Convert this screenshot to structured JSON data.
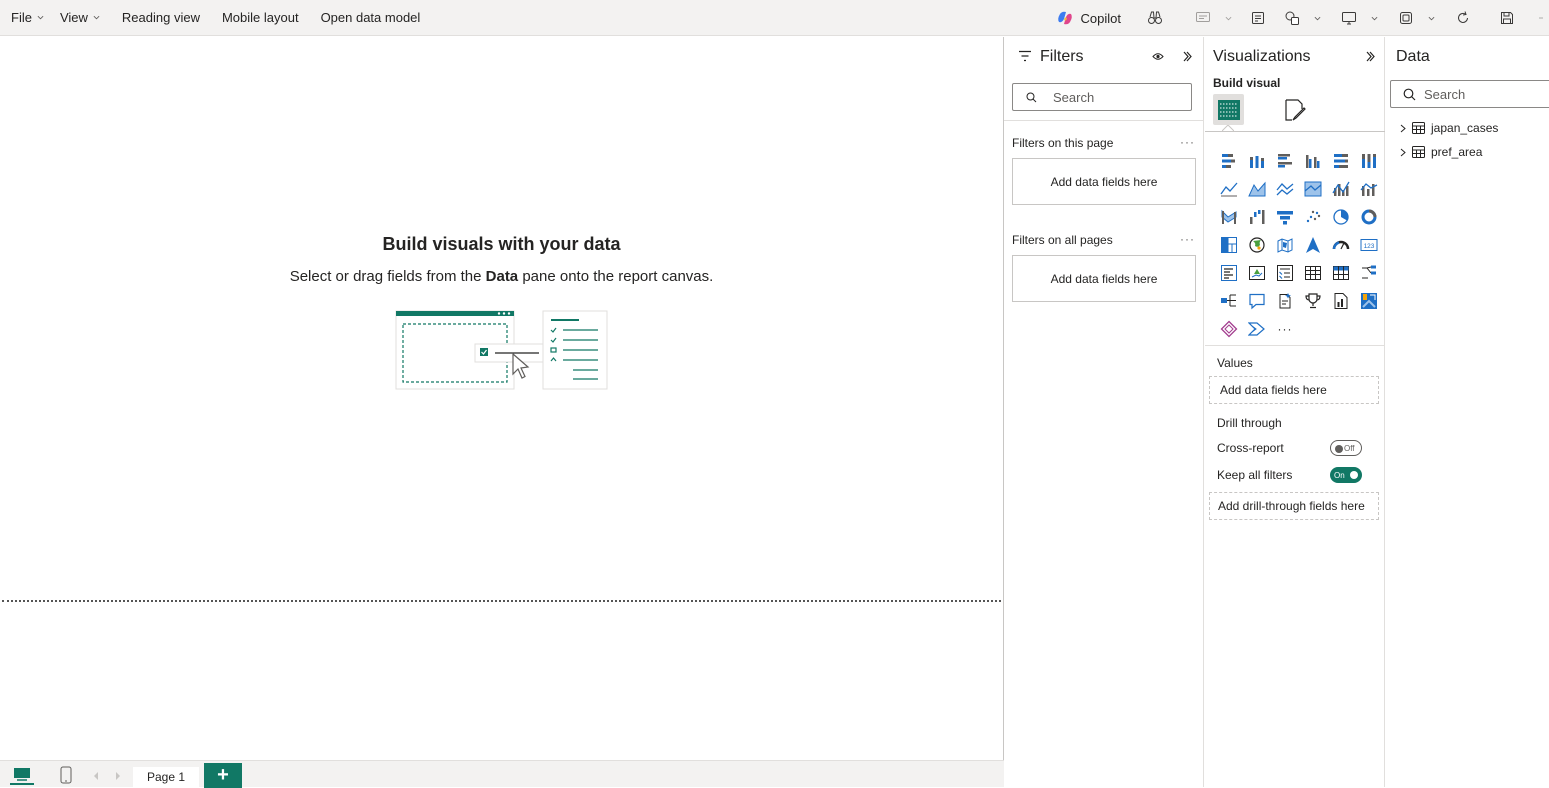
{
  "menu": {
    "file": "File",
    "view": "View",
    "reading_view": "Reading view",
    "mobile_layout": "Mobile layout",
    "open_data_model": "Open data model"
  },
  "toolbar": {
    "copilot": "Copilot",
    "icons": [
      "binoculars-icon",
      "comment-icon",
      "notes-icon",
      "shapes-icon",
      "present-icon",
      "app-icon",
      "refresh-icon",
      "save-icon",
      "more-icon"
    ]
  },
  "canvas": {
    "empty_title": "Build visuals with your data",
    "empty_sub_before": "Select or drag fields from the",
    "empty_sub_bold": "Data",
    "empty_sub_after": "pane onto the report canvas."
  },
  "bottom": {
    "page_tab": "Page 1",
    "add_page": "+"
  },
  "filters": {
    "title": "Filters",
    "search_placeholder": "Search",
    "on_this_page": "Filters on this page",
    "on_all_pages": "Filters on all pages",
    "add_fields": "Add data fields here",
    "ellipsis": "···"
  },
  "visualizations": {
    "title": "Visualizations",
    "build_visual": "Build visual",
    "more_visuals": "···",
    "values_label": "Values",
    "values_zone": "Add data fields here",
    "drill_through": "Drill through",
    "cross_report": "Cross-report",
    "cross_report_state": "Off",
    "keep_all_filters": "Keep all filters",
    "keep_all_filters_state": "On",
    "drill_zone": "Add drill-through fields here"
  },
  "data_pane": {
    "title": "Data",
    "search_placeholder": "Search",
    "tables": [
      "japan_cases",
      "pref_area"
    ]
  },
  "colors": {
    "accent": "#117865",
    "viz_blue": "#1f6fc5",
    "viz_orange": "#f2a40b"
  }
}
